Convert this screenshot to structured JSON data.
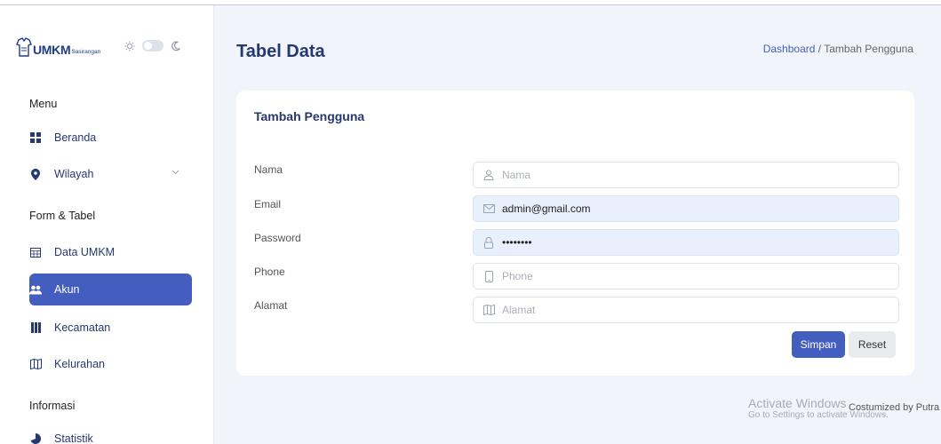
{
  "brand": {
    "name": "UMKM",
    "sub": "Sasirangan",
    "logo_icon": "shirt-logo-icon"
  },
  "theme": {
    "light_icon": "sun-icon",
    "dark_icon": "moon-icon"
  },
  "sidebar": {
    "sections": [
      "Menu",
      "Form & Tabel",
      "Informasi"
    ],
    "items": [
      {
        "label": "Beranda",
        "icon": "grid-icon"
      },
      {
        "label": "Wilayah",
        "icon": "map-pin-icon"
      },
      {
        "label": "Data UMKM",
        "icon": "table-icon"
      },
      {
        "label": "Akun",
        "icon": "users-icon",
        "active": true
      },
      {
        "label": "Kecamatan",
        "icon": "book-icon"
      },
      {
        "label": "Kelurahan",
        "icon": "map-icon"
      },
      {
        "label": "Statistik",
        "icon": "pie-chart-icon"
      }
    ]
  },
  "page": {
    "title": "Tabel Data"
  },
  "breadcrumb": {
    "link": "Dashboard",
    "separator": "/",
    "current": "Tambah Pengguna"
  },
  "form": {
    "title": "Tambah Pengguna",
    "fields": [
      {
        "label": "Nama",
        "placeholder": "Nama",
        "value": "",
        "icon": "person-icon"
      },
      {
        "label": "Email",
        "placeholder": "Email",
        "value": "admin@gmail.com",
        "icon": "envelope-icon"
      },
      {
        "label": "Password",
        "placeholder": "Password",
        "value": "••••••••",
        "icon": "lock-icon"
      },
      {
        "label": "Phone",
        "placeholder": "Phone",
        "value": "",
        "icon": "phone-icon"
      },
      {
        "label": "Alamat",
        "placeholder": "Alamat",
        "value": "",
        "icon": "map-icon"
      }
    ],
    "submit_label": "Simpan",
    "reset_label": "Reset"
  },
  "watermark": {
    "line1": "Activate Windows",
    "line2": "Go to Settings to activate Windows."
  },
  "footer": {
    "credit": "Costumized by Putra"
  },
  "colors": {
    "accent": "#435ebe",
    "heading": "#25396f",
    "background": "#f1f4fb"
  }
}
